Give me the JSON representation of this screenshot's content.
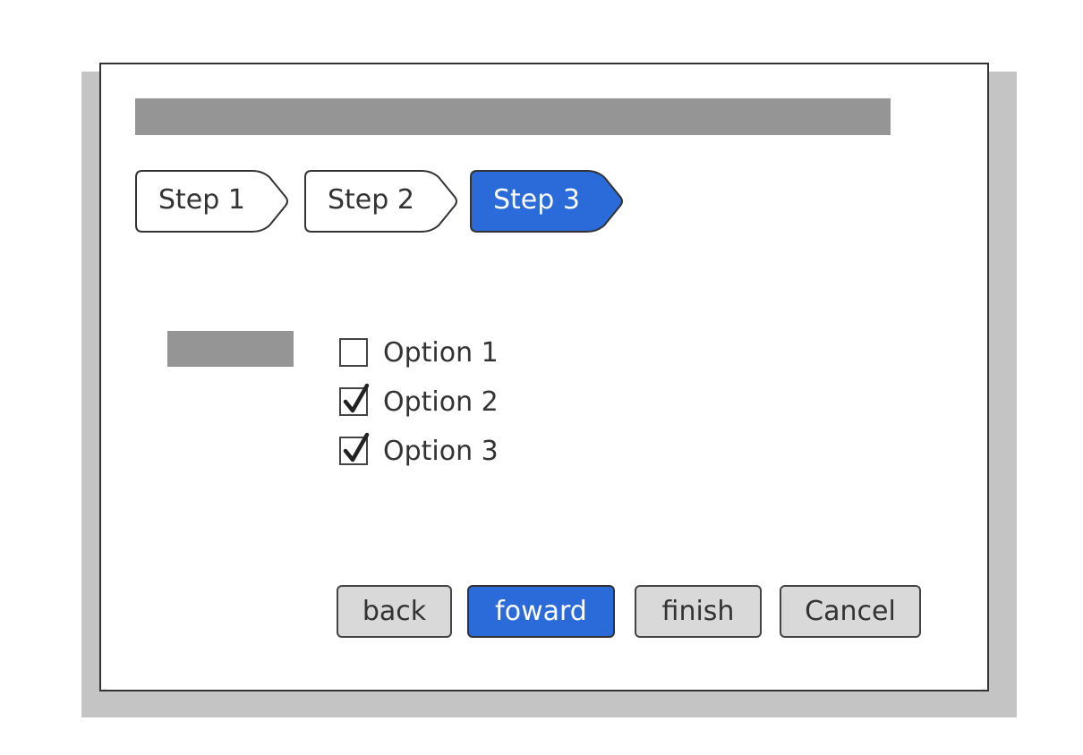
{
  "wizard": {
    "steps": [
      {
        "label": "Step 1",
        "active": false
      },
      {
        "label": "Step 2",
        "active": false
      },
      {
        "label": "Step 3",
        "active": true
      }
    ],
    "options": [
      {
        "label": "Option 1",
        "checked": false
      },
      {
        "label": "Option 2",
        "checked": true
      },
      {
        "label": "Option 3",
        "checked": true
      }
    ],
    "buttons": {
      "back": "back",
      "forward": "foward",
      "finish": "finish",
      "cancel": "Cancel"
    }
  },
  "colors": {
    "accent": "#2a6ad9",
    "placeholder": "#959595",
    "shadow": "#c4c4c4",
    "button_bg": "#d9d9d9",
    "border": "#333333"
  }
}
